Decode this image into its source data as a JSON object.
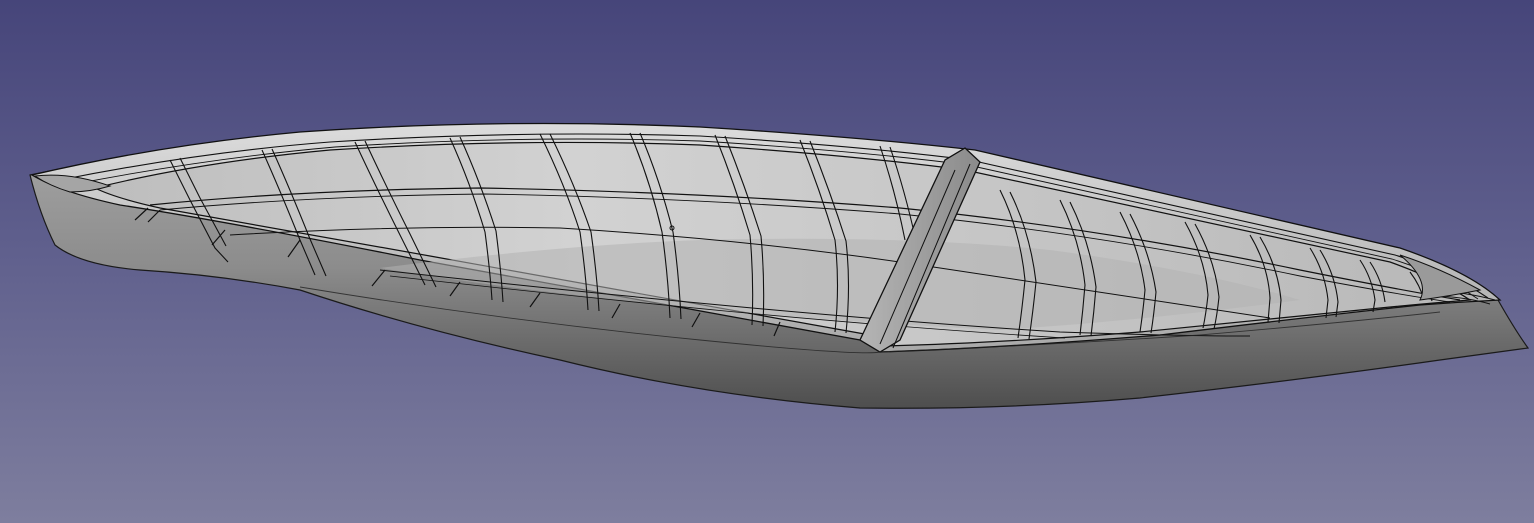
{
  "viewport": {
    "background_top": "#46457a",
    "background_bottom": "#7e7e9e"
  },
  "model": {
    "type": "boat-hull",
    "shading": "flat-lines",
    "hull_color": "#8d8d8d",
    "interior_color": "#c4c4c4",
    "edge_color": "#111111"
  }
}
